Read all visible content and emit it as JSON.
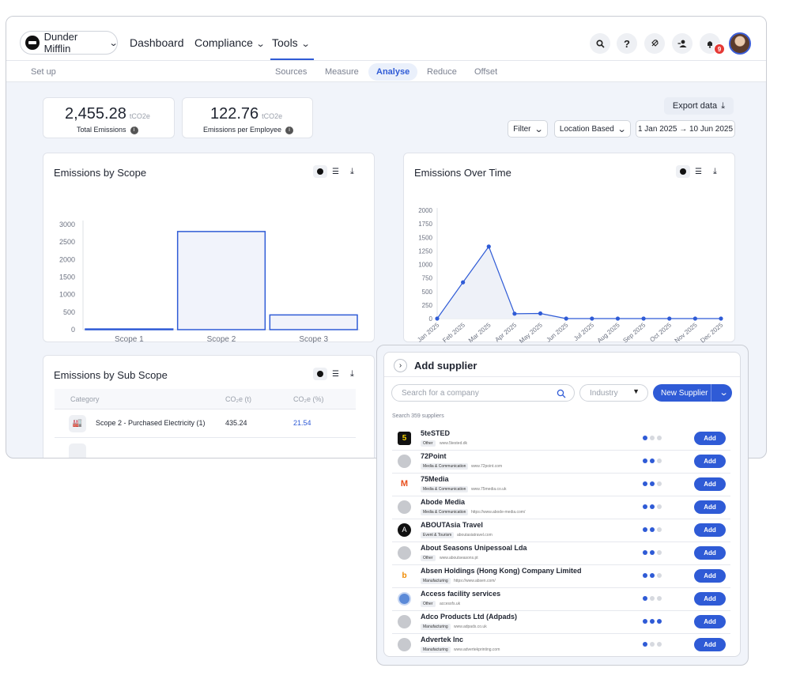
{
  "topnav": {
    "org_name": "Dunder Mifflin",
    "links": [
      "Dashboard",
      "Compliance",
      "Tools"
    ],
    "notification_count": "9"
  },
  "subnav": {
    "setup": "Set up",
    "items": [
      "Sources",
      "Measure",
      "Analyse",
      "Reduce",
      "Offset"
    ],
    "active": "Analyse"
  },
  "kpis": {
    "total_value": "2,455.28",
    "total_unit": "tCO2e",
    "total_label": "Total Emissions",
    "per_emp_value": "122.76",
    "per_emp_unit": "tCO2e",
    "per_emp_label": "Emissions per Employee"
  },
  "controls": {
    "export": "Export data",
    "filter": "Filter",
    "location": "Location Based",
    "date_range": "1 Jan 2025 → 10 Jun 2025"
  },
  "scope_card": {
    "title": "Emissions by Scope"
  },
  "time_card": {
    "title": "Emissions Over Time"
  },
  "subscope_card": {
    "title": "Emissions by Sub Scope",
    "columns": [
      "Category",
      "CO₂e (t)",
      "CO₂e (%)"
    ],
    "rows": [
      {
        "category": "Scope 2 - Purchased Electricity (1)",
        "tonnes": "435.24",
        "percent": "21.54"
      }
    ]
  },
  "chart_data": [
    {
      "type": "bar",
      "categories": [
        "Scope 1",
        "Scope 2",
        "Scope 3"
      ],
      "values": [
        20,
        2800,
        420
      ],
      "yticks": [
        "0",
        "500",
        "1000",
        "1500",
        "2000",
        "2500",
        "3000"
      ],
      "ylim": [
        0,
        3000
      ],
      "color": "#2f5bd6"
    },
    {
      "type": "area",
      "categories": [
        "Jan 2025",
        "Feb 2025",
        "Mar 2025",
        "Apr 2025",
        "May 2025",
        "Jun 2025",
        "Jul 2025",
        "Aug 2025",
        "Sep 2025",
        "Oct 2025",
        "Nov 2025",
        "Dec 2025"
      ],
      "values": [
        0,
        670,
        1330,
        90,
        95,
        0,
        0,
        0,
        0,
        0,
        0,
        0
      ],
      "yticks": [
        "0",
        "250",
        "500",
        "750",
        "1000",
        "1250",
        "1500",
        "1750",
        "2000"
      ],
      "ylim": [
        0,
        2000
      ],
      "color": "#2f5bd6"
    }
  ],
  "supplier_panel": {
    "title": "Add supplier",
    "search_placeholder": "Search for a company",
    "industry_placeholder": "Industry",
    "new_supplier": "New Supplier",
    "count_text": "Search 359 suppliers",
    "add_label": "Add",
    "suppliers": [
      {
        "name": "5teSTED",
        "tag": "Other",
        "url": "www.5tested.dk",
        "rating": 1,
        "logo": "5"
      },
      {
        "name": "72Point",
        "tag": "Media & Communication",
        "url": "www.72point.com",
        "rating": 2,
        "logo": ""
      },
      {
        "name": "75Media",
        "tag": "Media & Communication",
        "url": "www.75media.co.uk",
        "rating": 2,
        "logo": "M"
      },
      {
        "name": "Abode Media",
        "tag": "Media & Communication",
        "url": "https://www.abode-media.com/",
        "rating": 2,
        "logo": ""
      },
      {
        "name": "ABOUTAsia Travel",
        "tag": "Event & Tourism",
        "url": "aboutasiatravel.com",
        "rating": 2,
        "logo": "A"
      },
      {
        "name": "About Seasons Unipessoal Lda",
        "tag": "Other",
        "url": "www.aboutseasons.pt",
        "rating": 2,
        "logo": ""
      },
      {
        "name": "Absen Holdings (Hong Kong) Company Limited",
        "tag": "Manufacturing",
        "url": "https://www.absen.com/",
        "rating": 2,
        "logo": "b"
      },
      {
        "name": "Access facility services",
        "tag": "Other",
        "url": "accessfs.uk",
        "rating": 1,
        "logo": "o"
      },
      {
        "name": "Adco Products Ltd (Adpads)",
        "tag": "Manufacturing",
        "url": "www.adpads.co.uk",
        "rating": 3,
        "logo": ""
      },
      {
        "name": "Advertek Inc",
        "tag": "Manufacturing",
        "url": "www.advertekprinting.com",
        "rating": 1,
        "logo": ""
      }
    ]
  }
}
